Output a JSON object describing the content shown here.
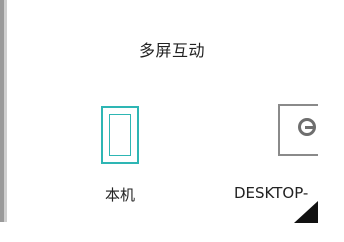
{
  "title": "多屏互动",
  "devices": [
    {
      "label": "本机",
      "icon": "phone-icon",
      "selected": true
    },
    {
      "label": "DESKTOP-",
      "icon": "monitor-icon",
      "selected": false
    }
  ],
  "colors": {
    "accent": "#2eb6b4",
    "text": "#222222",
    "icon_gray": "#8a8a8a"
  }
}
